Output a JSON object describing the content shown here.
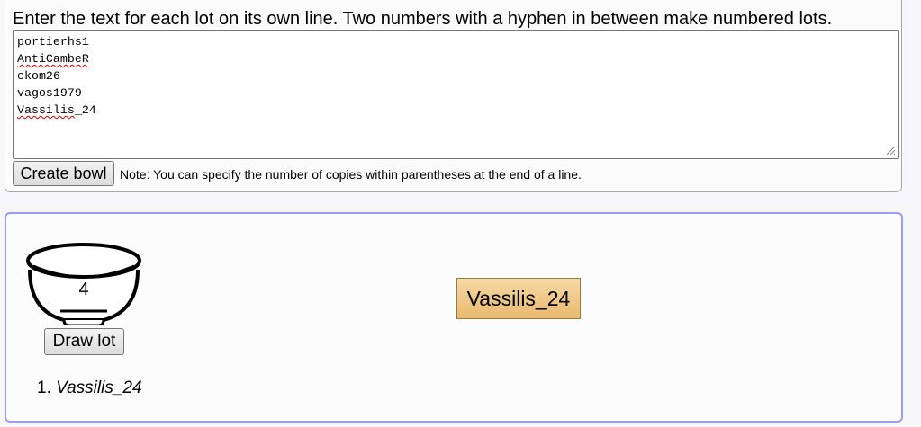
{
  "instruction": "Enter the text for each lot on its own line. Two numbers with a hyphen in between make numbered lots.",
  "lots_text": {
    "lines": [
      {
        "text": "portierhs1",
        "misspelled": false
      },
      {
        "text": "AntiCambeR",
        "misspelled": true
      },
      {
        "text": "ckom26",
        "misspelled": false
      },
      {
        "text": "vagos1979",
        "misspelled": false
      },
      {
        "text": "Vassilis_24",
        "misspelled": true,
        "underline_part": "Vassilis",
        "rest": "_24"
      }
    ]
  },
  "create_button_label": "Create bowl",
  "note": "Note: You can specify the number of copies within parentheses at the end of a line.",
  "bowl": {
    "count": "4",
    "icon": "bowl-icon",
    "draw_button_label": "Draw lot"
  },
  "drawn_lot": "Vassilis_24",
  "drawn_list": [
    {
      "number": "1.",
      "value": "Vassilis_24"
    }
  ],
  "colors": {
    "bowl_panel_border": "#9a9df0",
    "lot_card_fill": "#efc88a",
    "spellcheck_underline": "#d40000"
  }
}
